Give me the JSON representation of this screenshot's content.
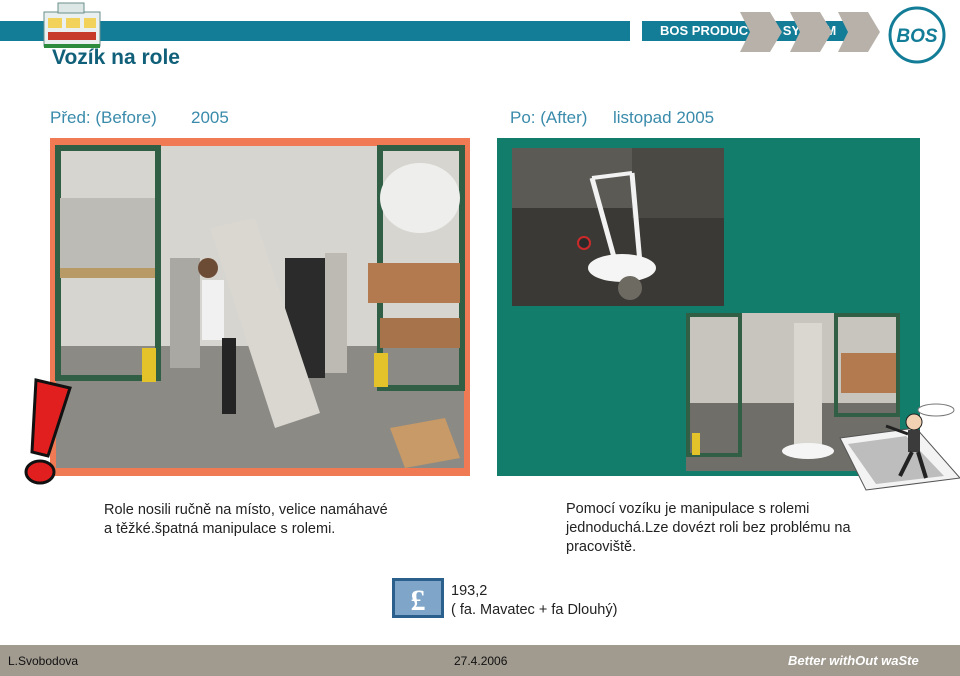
{
  "header": {
    "brand": "BOS PRODUCTION SYSTEM",
    "logo_text": "BOS",
    "title": "Vozík na role",
    "colors": {
      "bar": "#137d98",
      "chevron": "#b7b1a9",
      "logo": "#137d98"
    }
  },
  "before": {
    "label": "Před: (Before)",
    "year": "2005",
    "caption_line1": "Role nosili ručně na místo, velice namáhavé",
    "caption_line2": "a těžké.špatná manipulace s rolemi."
  },
  "after": {
    "label": "Po: (After)",
    "date": "listopad 2005",
    "caption_line1": "Pomocí vozíku je manipulace s rolemi",
    "caption_line2": "jednoduchá.Lze dovézt roli bez problému na",
    "caption_line3": "pracoviště."
  },
  "savings": {
    "icon": "pound-currency-icon",
    "amount": "193,2",
    "supplier": "( fa. Mavatec + fa Dlouhý)"
  },
  "footer": {
    "author": "L.Svobodova",
    "date": "27.4.2006",
    "tagline": "Better withOut waSte"
  }
}
